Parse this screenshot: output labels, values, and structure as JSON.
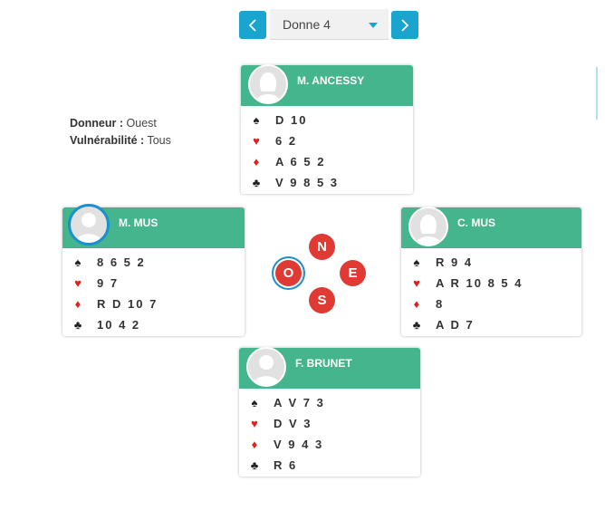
{
  "nav": {
    "prev_label": "<",
    "next_label": ">",
    "deal_value": "Donne 4"
  },
  "info": {
    "dealer_label": "Donneur :",
    "dealer_value": "Ouest",
    "vuln_label": "Vulnérabilité :",
    "vuln_value": "Tous"
  },
  "compass": {
    "north": "N",
    "west": "O",
    "east": "E",
    "south": "S",
    "active": "O"
  },
  "suits": {
    "spade": "♠",
    "heart": "♥",
    "diamond": "♦",
    "club": "♣"
  },
  "hands": {
    "north": {
      "name": "M. ANCESSY",
      "spades": "D 10",
      "hearts": "6 2",
      "diamonds": "A 6 5 2",
      "clubs": "V 9 8 5 3"
    },
    "west": {
      "name": "M. MUS",
      "spades": "8 6 5 2",
      "hearts": "9 7",
      "diamonds": "R D 10 7",
      "clubs": "10 4 2"
    },
    "east": {
      "name": "C. MUS",
      "spades": "R 9 4",
      "hearts": "A R 10 8 5 4",
      "diamonds": "8",
      "clubs": "A D 7"
    },
    "south": {
      "name": "F. BRUNET",
      "spades": "A V 7 3",
      "hearts": "D V 3",
      "diamonds": "V 9 4 3",
      "clubs": "R 6"
    }
  },
  "colors": {
    "accent": "#1aa5cf",
    "header_green": "#44b58c",
    "seat_red": "#e03a34",
    "suit_red": "#e0211d"
  },
  "icons": {
    "prev": "chevron-left-icon",
    "next": "chevron-right-icon",
    "avatar": "user-avatar-icon"
  }
}
